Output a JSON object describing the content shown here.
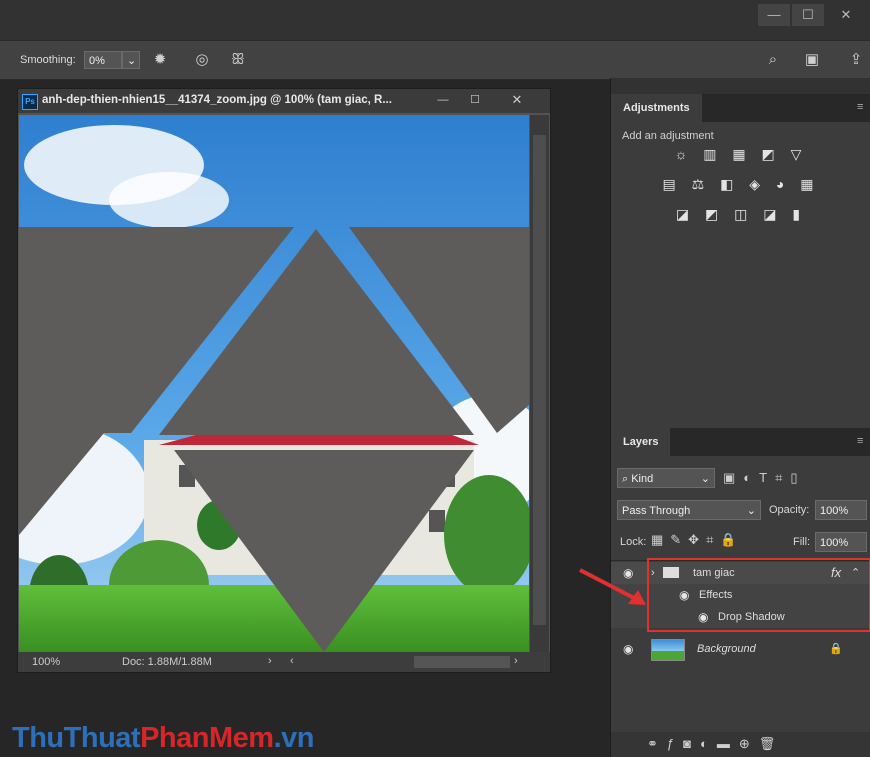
{
  "window": {
    "minimize": "—",
    "maximize": "☐",
    "close": "✕"
  },
  "options": {
    "smoothing_label": "Smoothing:",
    "smoothing_value": "0%",
    "icons": [
      "gear-icon",
      "target-icon",
      "butterfly-icon",
      "search-icon",
      "workspace-icon",
      "share-icon"
    ]
  },
  "document": {
    "title": "anh-dep-thien-nhien15__41374_zoom.jpg @ 100% (tam giac, R...",
    "ps_badge": "Ps",
    "zoom": "100%",
    "doc_info": "Doc: 1.88M/1.88M"
  },
  "adjustments": {
    "tab": "Adjustments",
    "hint": "Add an adjustment",
    "rows": [
      "☼ ▥ ▦ ◩ ▽",
      "▤ ⚖ ◧ ◈ ◕ ▦",
      "◪ ◩ ◫ ◪ ▮"
    ]
  },
  "layers": {
    "tab": "Layers",
    "kind": "Kind",
    "blend_mode": "Pass Through",
    "opacity_label": "Opacity:",
    "opacity_value": "100%",
    "lock_label": "Lock:",
    "fill_label": "Fill:",
    "fill_value": "100%",
    "items": {
      "group_name": "tam giac",
      "fx": "fx",
      "effects": "Effects",
      "drop_shadow": "Drop Shadow",
      "background": "Background"
    }
  },
  "watermark": {
    "part1": "ThuThuat",
    "part2": "PhanMem",
    "part3": ".vn"
  },
  "colors": {
    "highlight": "#e03030",
    "triangle": "#5e5b5b",
    "sky": "#3d8fd8"
  }
}
